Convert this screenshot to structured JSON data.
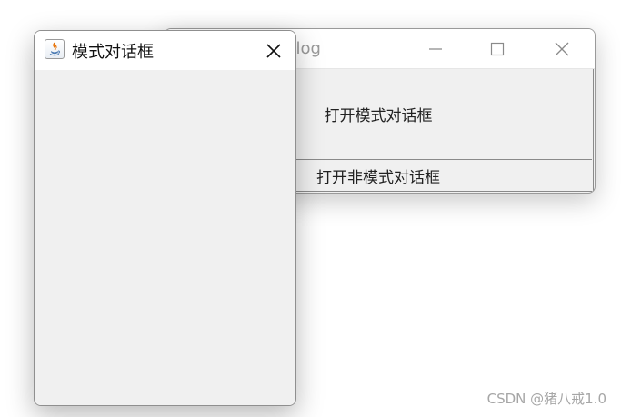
{
  "back_window": {
    "title_visible": "log",
    "open_modal_label": "打开模式对话框",
    "open_nonmodal_label": "打开非模式对话框",
    "icons": [
      "minimize-icon",
      "maximize-icon",
      "close-icon"
    ]
  },
  "modal_dialog": {
    "title": "模式对话框",
    "icon": "java-icon",
    "close_icon": "close-icon"
  },
  "watermark": "CSDN @猪八戒1.0",
  "colors": {
    "window_bg": "#f0f0f0",
    "titlebar_bg": "#ffffff",
    "border": "#8f8f8f",
    "text": "#222222",
    "watermark": "#a6a6a6"
  }
}
